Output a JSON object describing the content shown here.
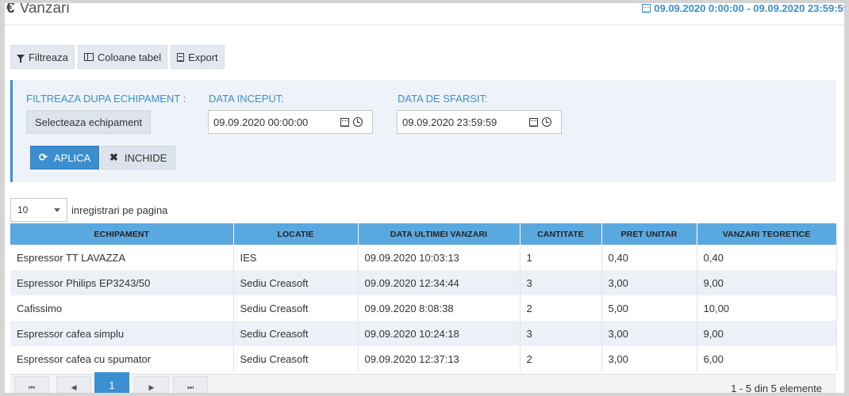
{
  "header": {
    "title": "Vanzari",
    "currency_icon": "euro-icon",
    "date_range": "09.09.2020 0:00:00 - 09.09.2020 23:59:59"
  },
  "toolbar": {
    "filter_label": "Filtreaza",
    "columns_label": "Coloane tabel",
    "export_label": "Export"
  },
  "filter": {
    "equipment_label": "FILTREAZA DUPA ECHIPAMENT :",
    "select_equipment": "Selecteaza echipament",
    "start_label": "DATA INCEPUT:",
    "start_value": "09.09.2020 00:00:00",
    "end_label": "DATA DE SFARSIT:",
    "end_value": "09.09.2020 23:59:59",
    "apply_label": "APLICA",
    "close_label": "INCHIDE"
  },
  "page_size": {
    "value": "10",
    "label": "inregistrari pe pagina"
  },
  "table": {
    "columns": [
      "ECHIPAMENT",
      "LOCATIE",
      "DATA ULTIMEI VANZARI",
      "CANTITATE",
      "PRET UNITAR",
      "VANZARI TEORETICE"
    ],
    "rows": [
      [
        "Espressor TT LAVAZZA",
        "IES",
        "09.09.2020 10:03:13",
        "1",
        "0,40",
        "0,40"
      ],
      [
        "Espressor Philips EP3243/50",
        "Sediu Creasoft",
        "09.09.2020 12:34:44",
        "3",
        "3,00",
        "9,00"
      ],
      [
        "Cafissimo",
        "Sediu Creasoft",
        "09.09.2020 8:08:38",
        "2",
        "5,00",
        "10,00"
      ],
      [
        "Espressor cafea simplu",
        "Sediu Creasoft",
        "09.09.2020 10:24:18",
        "3",
        "3,00",
        "9,00"
      ],
      [
        "Espressor cafea cu spumator",
        "Sediu Creasoft",
        "09.09.2020 12:37:13",
        "2",
        "3,00",
        "6,00"
      ]
    ]
  },
  "pager": {
    "current_page": "1",
    "info": "1 - 5 din 5 elemente"
  }
}
